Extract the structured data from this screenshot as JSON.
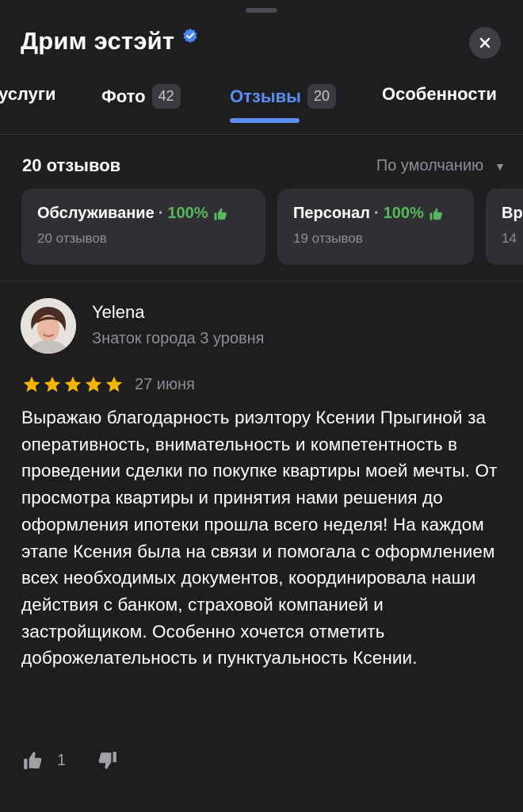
{
  "header": {
    "title": "Дрим эстэйт",
    "verified_icon": "verified-badge-icon",
    "close_icon": "close-icon"
  },
  "tabs": [
    {
      "label": "услуги",
      "badge": null,
      "active": false
    },
    {
      "label": "Фото",
      "badge": "42",
      "active": false
    },
    {
      "label": "Отзывы",
      "badge": "20",
      "active": true
    },
    {
      "label": "Особенности",
      "badge": null,
      "active": false
    }
  ],
  "reviews_summary": {
    "count_label": "20 отзывов",
    "sort_label": "По умолчанию"
  },
  "aspect_cards": [
    {
      "name": "Обслуживание",
      "percent": "100%",
      "reviews": "20 отзывов"
    },
    {
      "name": "Персонал",
      "percent": "100%",
      "reviews": "19 отзывов"
    },
    {
      "name": "Вр",
      "percent": "",
      "reviews": "14"
    }
  ],
  "review": {
    "author": "Yelena",
    "level": "Знаток города 3 уровня",
    "rating": 5,
    "date": "27 июня",
    "text": "Выражаю благодарность риэлтору Ксении Прыгиной за оперативность, внимательность и компетентность в проведении сделки по покупке квартиры моей мечты. От просмотра квартиры и принятия нами решения до оформления ипотеки прошла всего неделя! На каждом этапе Ксения была на связи и помогала с оформлением всех необходимых документов, координировала наши действия с банком, страховой компанией и застройщиком. Особенно хочется отметить доброжелательность и пунктуальность Ксении.",
    "likes": "1"
  },
  "colors": {
    "background": "#1e1e21",
    "accent": "#5b8ef5",
    "positive": "#56b85a",
    "star": "#f5b400",
    "muted_text": "#8e8e93"
  }
}
